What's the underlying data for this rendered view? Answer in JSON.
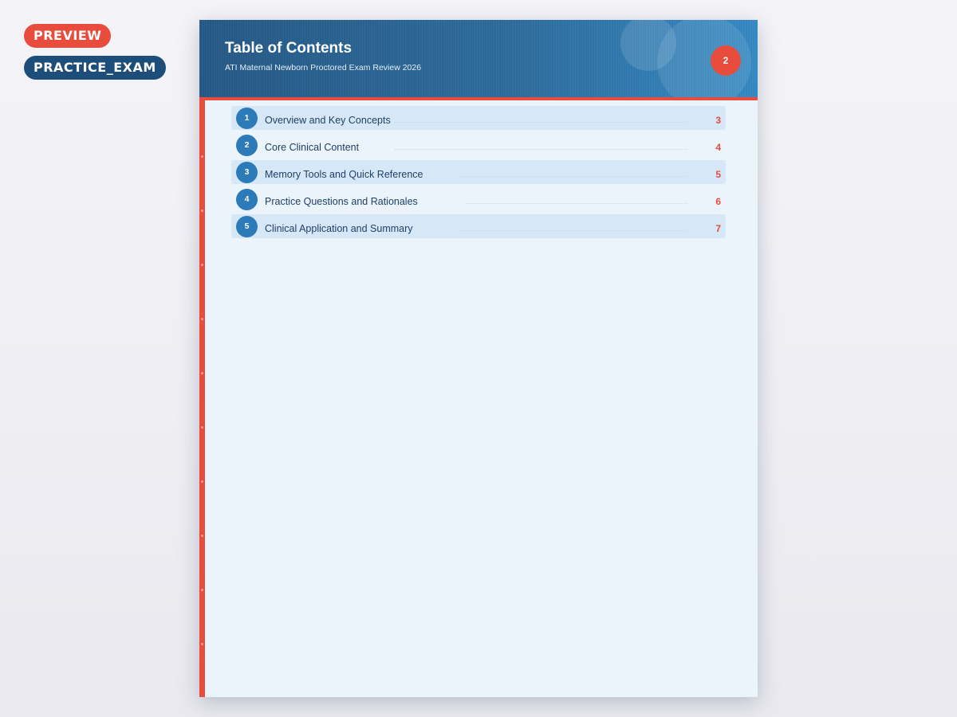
{
  "badges": {
    "preview": "PREVIEW",
    "doc_type": "PRACTICE_EXAM"
  },
  "page": {
    "title": "Table of Contents",
    "subtitle": "ATI Maternal Newborn Proctored Exam Review 2026",
    "number": "2"
  },
  "toc": {
    "items": [
      {
        "num": "1",
        "label": "Overview and Key Concepts",
        "page": "3"
      },
      {
        "num": "2",
        "label": "Core Clinical Content",
        "page": "4"
      },
      {
        "num": "3",
        "label": "Memory Tools and Quick Reference",
        "page": "5"
      },
      {
        "num": "4",
        "label": "Practice Questions and Rationales",
        "page": "6"
      },
      {
        "num": "5",
        "label": "Clinical Application and Summary",
        "page": "7"
      }
    ]
  },
  "colors": {
    "accent": "#e74c3c",
    "header_blue": "#2d6a9a",
    "badge_navy": "#1d4e79",
    "number_blue": "#2d7ab8",
    "page_bg": "#ebf3fb"
  }
}
